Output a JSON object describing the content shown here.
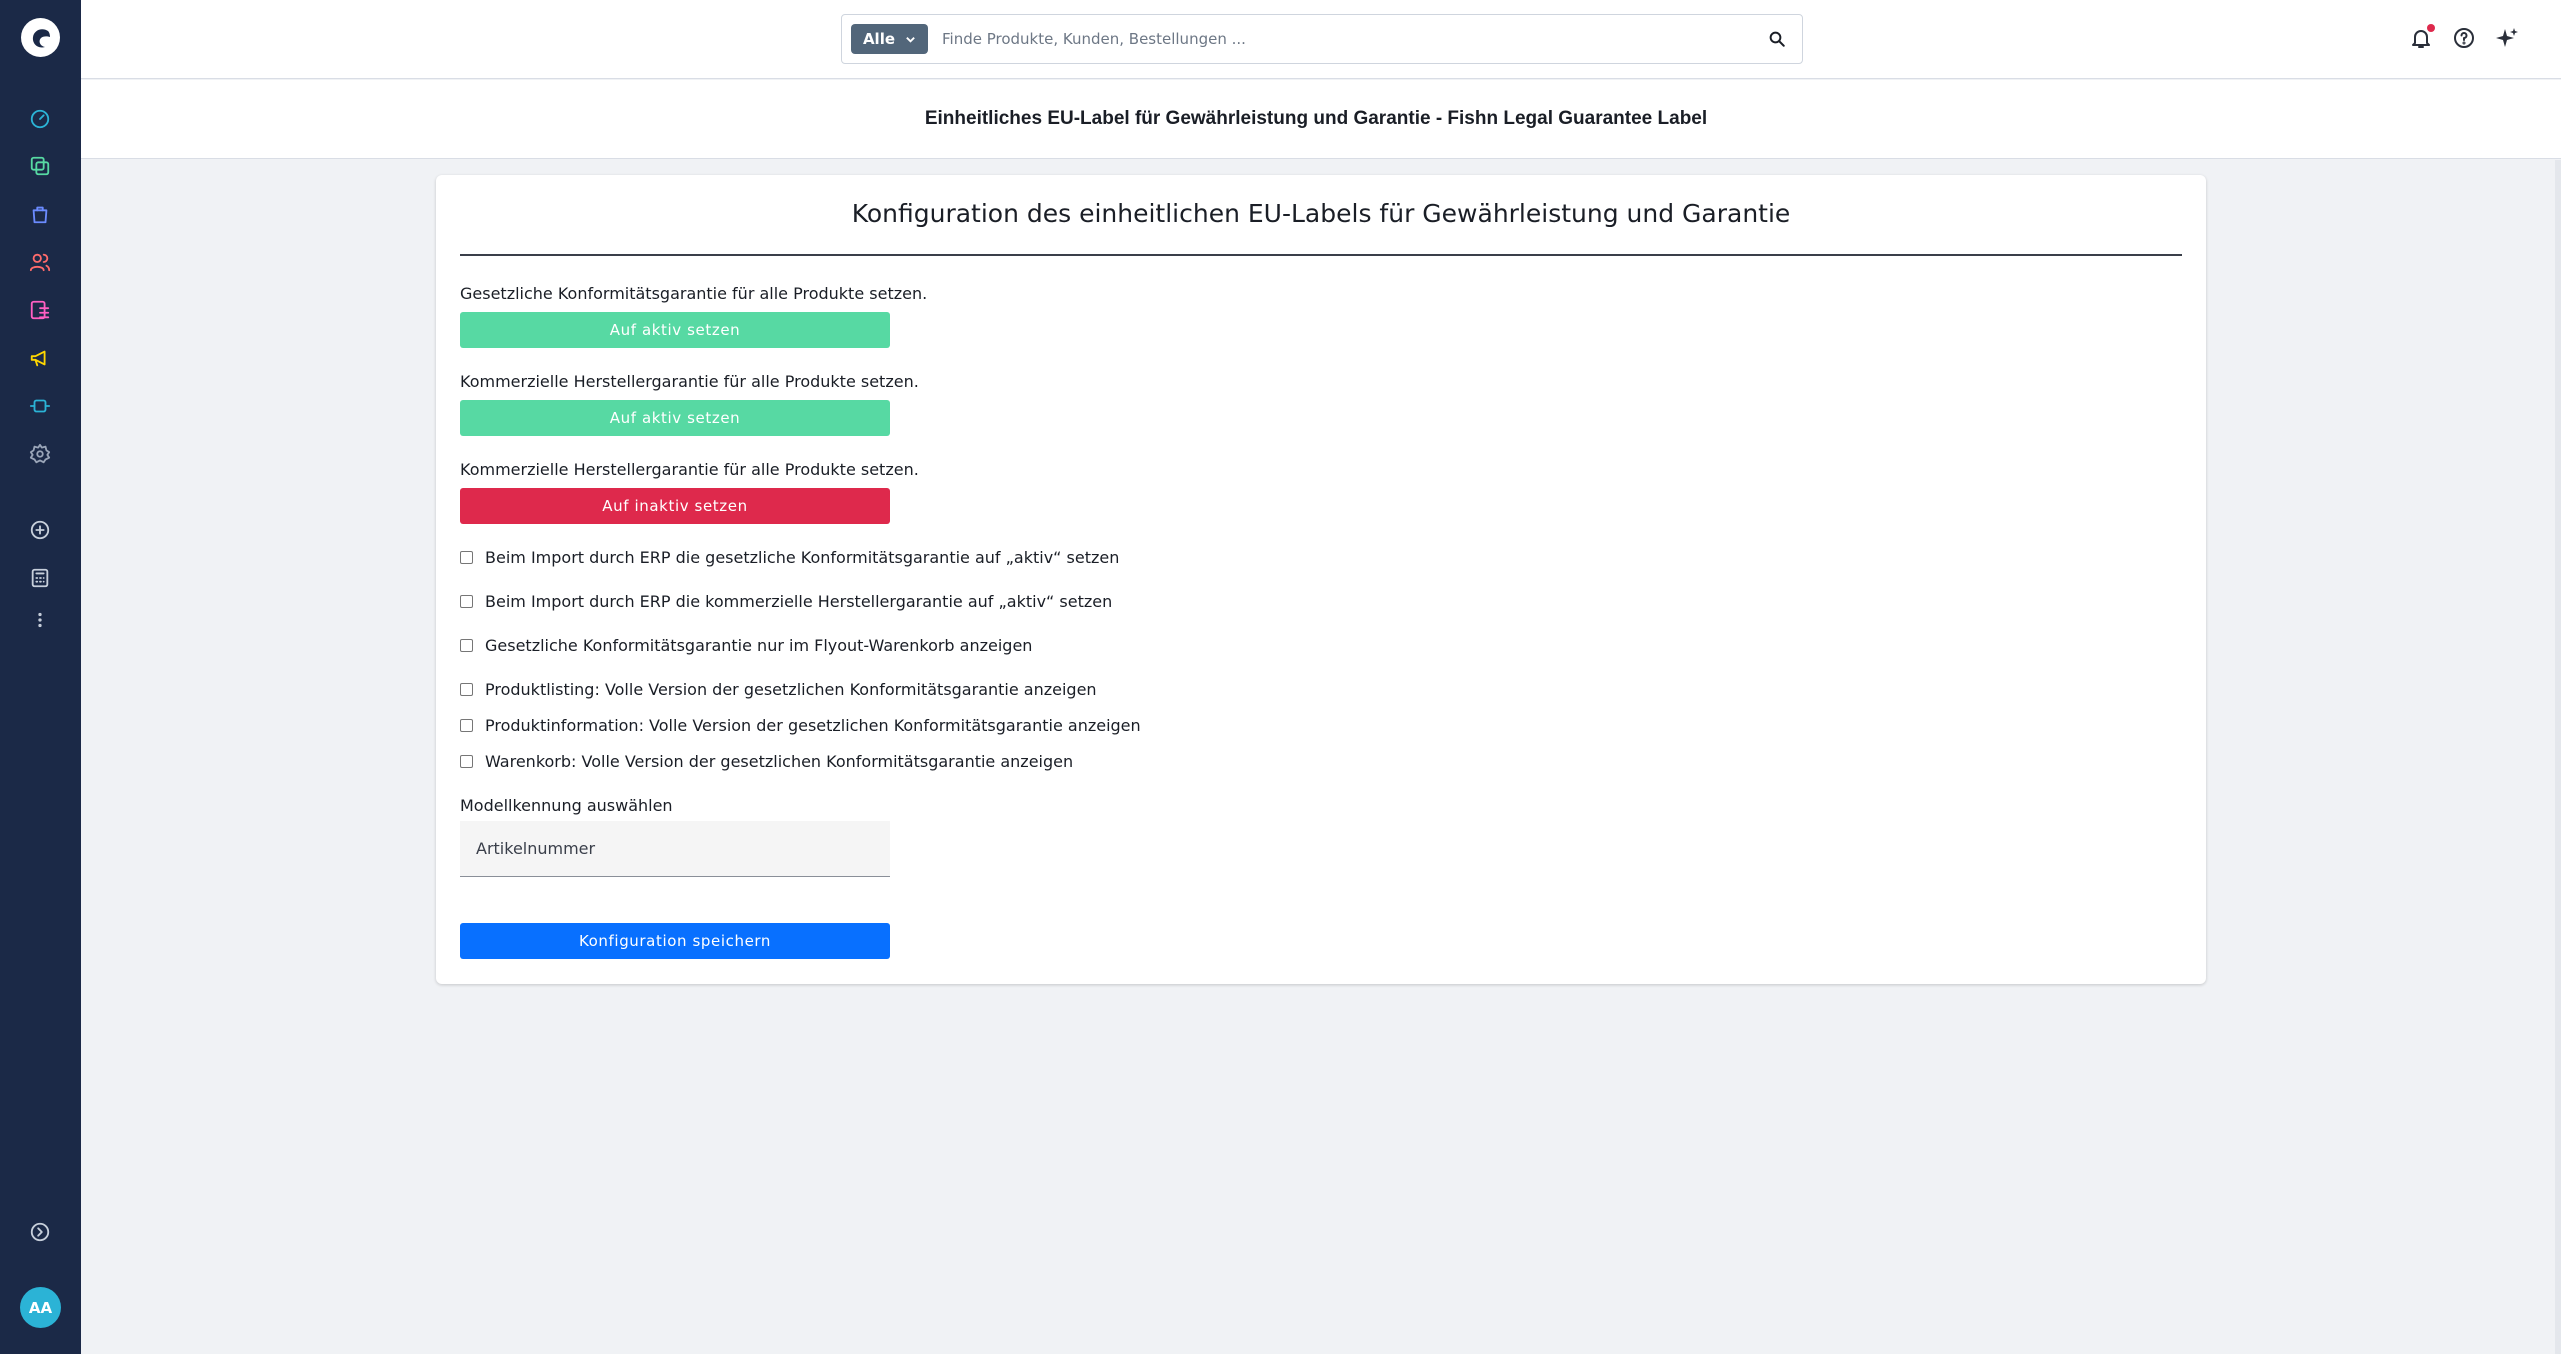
{
  "search": {
    "scope_label": "Alle",
    "placeholder": "Finde Produkte, Kunden, Bestellungen ..."
  },
  "page": {
    "title": "Einheitliches EU-Label für Gewährleistung und Garantie - Fishn Legal Guarantee Label"
  },
  "card": {
    "title": "Konfiguration des einheitlichen EU-Labels für Gewährleistung und Garantie",
    "sections": [
      {
        "label": "Gesetzliche Konformitätsgarantie für alle Produkte setzen.",
        "button": "Auf aktiv setzen"
      },
      {
        "label": "Kommerzielle Herstellergarantie für alle Produkte setzen.",
        "button": "Auf aktiv setzen"
      },
      {
        "label": "Kommerzielle Herstellergarantie für alle Produkte setzen.",
        "button": "Auf inaktiv setzen"
      }
    ],
    "checkboxes": [
      "Beim Import durch ERP die gesetzliche Konformitätsgarantie auf „aktiv“ setzen",
      "Beim Import durch ERP die kommerzielle Herstellergarantie auf „aktiv“ setzen",
      "Gesetzliche Konformitätsgarantie nur im Flyout-Warenkorb anzeigen",
      "Produktlisting: Volle Version der gesetzlichen Konformitätsgarantie anzeigen",
      "Produktinformation: Volle Version der gesetzlichen Konformitätsgarantie anzeigen",
      "Warenkorb: Volle Version der gesetzlichen Konformitätsgarantie anzeigen"
    ],
    "model_label": "Modellkennung auswählen",
    "model_value": "Artikelnummer",
    "save_button": "Konfiguration speichern"
  },
  "user": {
    "initials": "AA"
  },
  "colors": {
    "sidebar": "#1b2947",
    "green_button": "#57d9a3",
    "red_button": "#de294c",
    "blue_button": "#0870ff",
    "avatar": "#2bb3d6"
  },
  "icons": {
    "sidebar": [
      "dashboard-icon",
      "catalog-icon",
      "orders-icon",
      "customers-icon",
      "content-icon",
      "marketing-icon",
      "extensions-icon",
      "settings-icon",
      "add-icon",
      "calculator-icon",
      "more-icon",
      "expand-icon"
    ],
    "topbar": [
      "bell-icon",
      "help-icon",
      "sparkle-icon"
    ]
  }
}
